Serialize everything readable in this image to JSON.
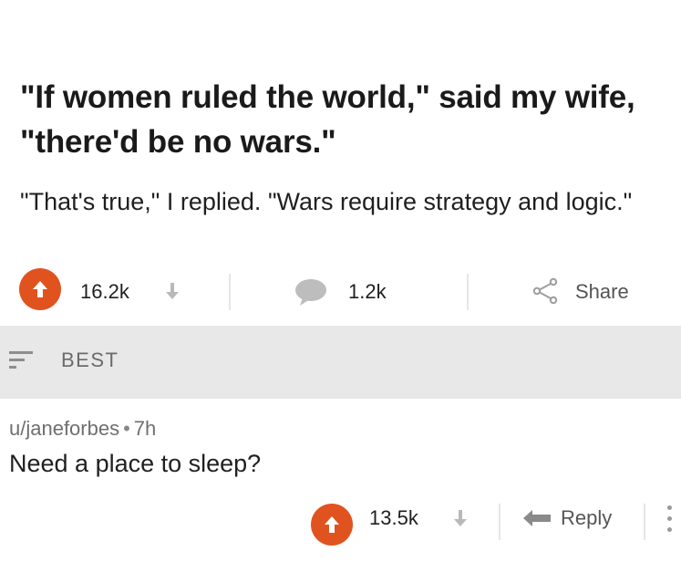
{
  "post": {
    "title": "\"If women ruled the world,\" said my wife, \"there'd be no wars.\"",
    "body": "\"That's true,\" I replied. \"Wars require strategy and logic.\"",
    "upvotes": "16.2k",
    "comments": "1.2k",
    "share_label": "Share"
  },
  "sort": {
    "label": "BEST"
  },
  "comment": {
    "author": "u/janeforbes",
    "separator": "•",
    "age": "7h",
    "text": "Need a place to sleep?",
    "upvotes": "13.5k",
    "reply_label": "Reply"
  },
  "colors": {
    "upvote": "#e0531f",
    "sort_bar_bg": "#e8e8e8",
    "meta_gray": "#6f6f6f"
  },
  "icons": {
    "upvote": "arrow-up-circle-icon",
    "downvote": "arrow-down-icon",
    "comments": "speech-bubble-icon",
    "share": "share-nodes-icon",
    "sort": "sort-lines-icon",
    "reply": "reply-arrow-icon",
    "more": "vertical-dots-icon"
  }
}
